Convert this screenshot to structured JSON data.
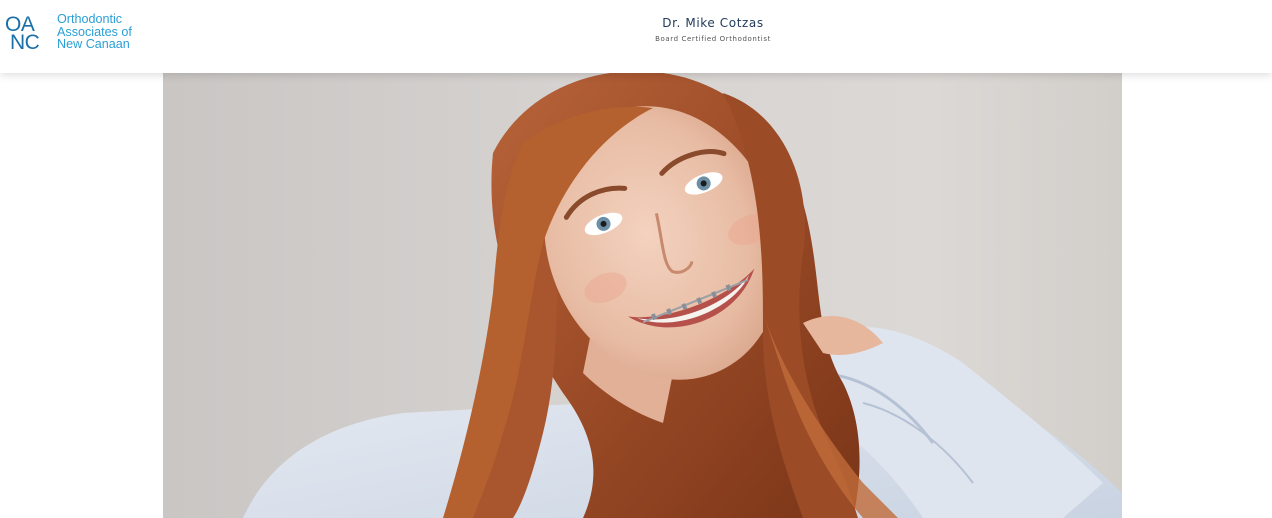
{
  "header": {
    "logo": {
      "mark_line1": "OA",
      "mark_line2": "NC",
      "name_lines": [
        "Orthodontic",
        "Associates of",
        "New Canaan"
      ]
    },
    "doctor": {
      "name": "Dr. Mike Cotzas",
      "title": "Board Certified Orthodontist"
    }
  },
  "hero": {
    "image_subject": "smiling-woman-with-braces-photo"
  },
  "colors": {
    "brand_dark": "#1a6fa8",
    "brand_light": "#2a9fd6",
    "doctor_name": "#1f3a5a"
  }
}
